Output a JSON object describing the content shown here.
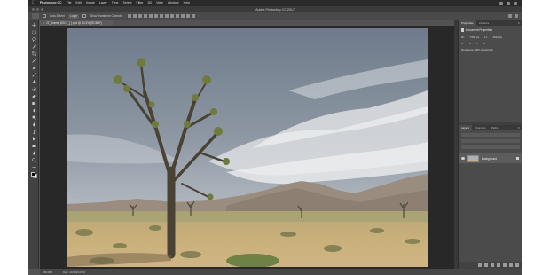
{
  "menubar": {
    "app_name": "Photoshop CC",
    "items": [
      "File",
      "Edit",
      "Image",
      "Layer",
      "Type",
      "Select",
      "Filter",
      "3D",
      "View",
      "Window",
      "Help"
    ]
  },
  "window": {
    "title": "Adobe Photoshop CC 2017"
  },
  "options": {
    "auto_select_label": "Auto-Select:",
    "auto_select_value": "Layer",
    "show_transform": "Show Transform Controls"
  },
  "document": {
    "tab_label": "JT_Scene_DSC7_[ ].psd @ 33.3% (RGB/8*)"
  },
  "status": {
    "zoom": "33.33%",
    "doc_info": "Doc: 14.5M/14.5M"
  },
  "properties_panel": {
    "tabs": [
      "Properties",
      "Libraries"
    ],
    "title": "Document Properties",
    "fields": [
      {
        "label": "W:",
        "value": "7360 px"
      },
      {
        "label": "H:",
        "value": "4912 px"
      },
      {
        "label": "X:",
        "value": "0"
      },
      {
        "label": "Y:",
        "value": "0"
      }
    ],
    "resolution": "Resolution: 300 pixels/inch"
  },
  "layers_panel": {
    "tabs": [
      "Layers",
      "Channels",
      "Paths"
    ],
    "layer_name": "Background"
  },
  "tools": [
    "move",
    "marquee",
    "lasso",
    "quick-select",
    "crop",
    "eyedropper",
    "healing",
    "brush",
    "clone",
    "history",
    "eraser",
    "gradient",
    "blur",
    "dodge",
    "pen",
    "type",
    "path-select",
    "shape",
    "hand",
    "zoom",
    "more"
  ]
}
